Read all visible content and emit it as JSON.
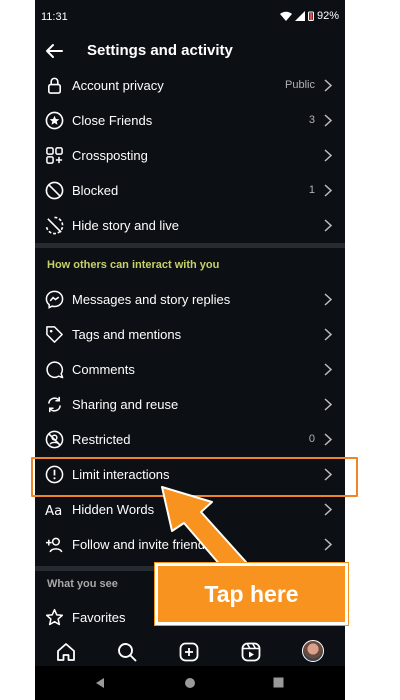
{
  "status_bar": {
    "time": "11:31",
    "battery": "92%"
  },
  "header": {
    "title": "Settings and activity"
  },
  "account_rows": [
    {
      "label": "Account privacy",
      "value": "Public",
      "icon": "lock-icon"
    },
    {
      "label": "Close Friends",
      "value": "3",
      "icon": "star-circle-icon"
    },
    {
      "label": "Crossposting",
      "value": "",
      "icon": "grid-plus-icon"
    },
    {
      "label": "Blocked",
      "value": "1",
      "icon": "blocked-icon"
    },
    {
      "label": "Hide story and live",
      "value": "",
      "icon": "hide-story-icon"
    }
  ],
  "interact_section": {
    "title": "How others can interact with you",
    "title_color": "#c8d06a",
    "rows": [
      {
        "label": "Messages and story replies",
        "value": "",
        "icon": "messenger-icon"
      },
      {
        "label": "Tags and mentions",
        "value": "",
        "icon": "tag-icon"
      },
      {
        "label": "Comments",
        "value": "",
        "icon": "comment-icon"
      },
      {
        "label": "Sharing and reuse",
        "value": "",
        "icon": "sharing-icon"
      },
      {
        "label": "Restricted",
        "value": "0",
        "icon": "restricted-icon"
      },
      {
        "label": "Limit interactions",
        "value": "",
        "icon": "limit-icon"
      },
      {
        "label": "Hidden Words",
        "value": "",
        "icon": "hidden-words-icon"
      },
      {
        "label": "Follow and invite friends",
        "value": "",
        "icon": "add-person-icon"
      }
    ]
  },
  "what_you_see_section": {
    "title": "What you see",
    "rows": [
      {
        "label": "Favorites",
        "value": "",
        "icon": "star-outline-icon"
      }
    ]
  },
  "bottom_nav": [
    "home-icon",
    "search-icon",
    "create-icon",
    "reels-icon",
    "profile-avatar"
  ],
  "annotation": {
    "callout_text": "Tap here",
    "accent_color": "#f7931e"
  }
}
